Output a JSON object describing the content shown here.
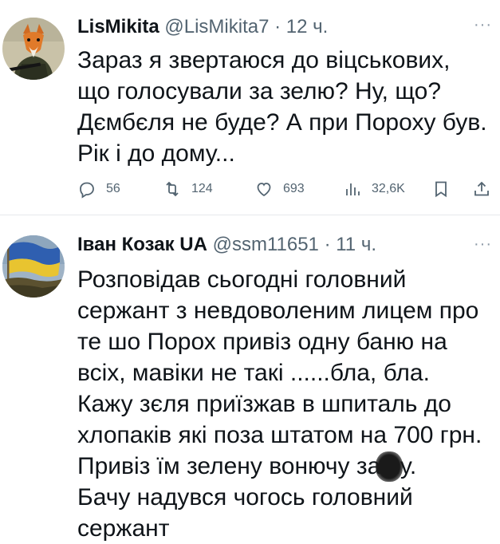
{
  "tweets": [
    {
      "author": "LisMikita",
      "handle": "@LisMikita7",
      "time": "· 12 ч.",
      "more": "···",
      "text": "Зараз я звертаюся до віцськових,\nщо голосували за зелю? Ну, що?\nДємбєля  не буде? А при Пороху був.\nРік і до дому...",
      "stats": {
        "replies": "56",
        "retweets": "124",
        "likes": "693",
        "views": "32,6K"
      }
    },
    {
      "author": "Іван Козак UA",
      "handle": "@ssm11651",
      "time": "· 11 ч.",
      "more": "···",
      "text": "Розповідав сьогодні головний\nсержант з невдоволеним лицем про\nте шо Порох привіз одну баню на\nвсіх, мавіки не такі ......бла, бла.\nКажу зєля приїзжав в шпиталь до\nхлопаків які поза штатом на 700 грн.\nПривіз їм зелену вонючу за    пу.\nБачу надувся чогось головний\nсержант"
    }
  ],
  "colors": {
    "text": "#0f1419",
    "meta": "#536471",
    "divider": "#e6e9ec"
  },
  "icons": [
    "reply-icon",
    "retweet-icon",
    "like-icon",
    "views-icon",
    "bookmark-icon",
    "share-icon",
    "more-icon"
  ]
}
